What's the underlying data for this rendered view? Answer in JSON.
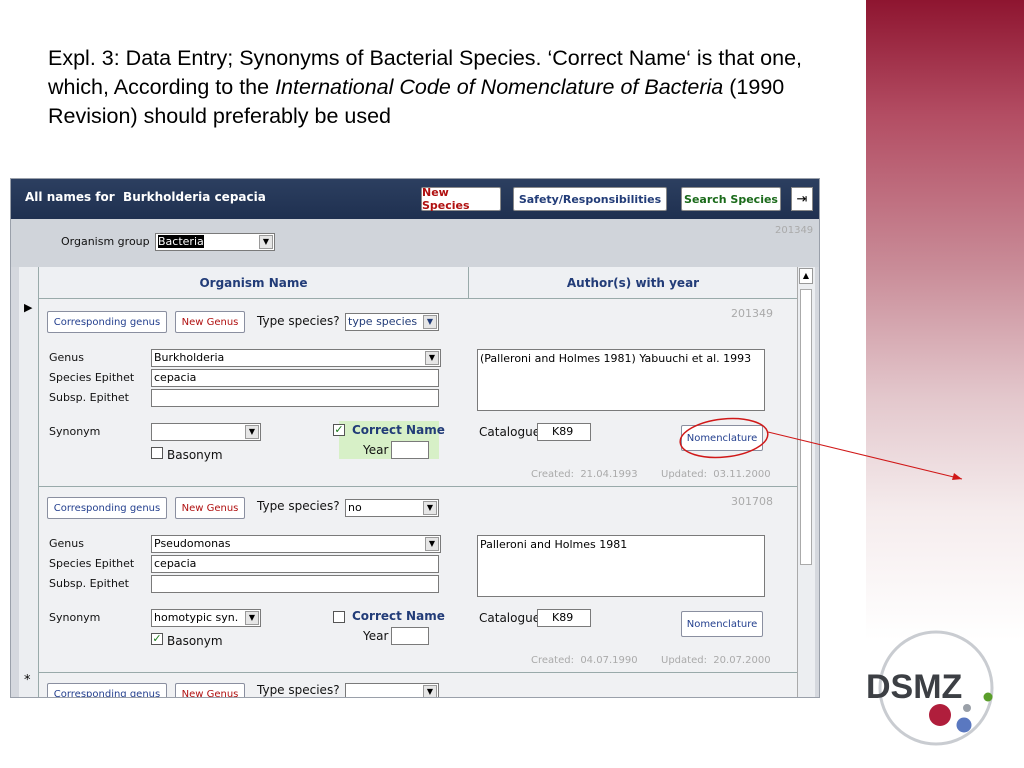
{
  "caption": {
    "part1": "Expl. 3: Data Entry; Synonyms of Bacterial Species. ‘Correct Name‘ is that one, which, According to the ",
    "italic1": "International Code of Nomenclature of Bacteria",
    "part2": " (1990 Revision) should preferably be used"
  },
  "window": {
    "title_prefix": "All names for",
    "title_name": "Burkholderia cepacia",
    "buttons": {
      "new_species": "New Species",
      "safety": "Safety/Responsibilities",
      "search": "Search Species"
    },
    "exit_icon": "exit-door-icon",
    "organism_group_label": "Organism group",
    "organism_group_value": "Bacteria",
    "record_id": "201349"
  },
  "grid": {
    "col_name": "Organism Name",
    "col_author": "Author(s) with year",
    "labels": {
      "corresponding_genus": "Corresponding genus",
      "new_genus": "New Genus",
      "type_species_q": "Type species?",
      "genus": "Genus",
      "species_epithet": "Species Epithet",
      "subsp_epithet": "Subsp. Epithet",
      "synonym": "Synonym",
      "basonym": "Basonym",
      "correct_name": "Correct Name",
      "year": "Year",
      "catalogue": "Catalogue",
      "nomenclature": "Nomenclature",
      "created": "Created:",
      "updated": "Updated:"
    },
    "records": [
      {
        "type_species": "type species",
        "id": "201349",
        "genus": "Burkholderia",
        "species_epithet": "cepacia",
        "subsp_epithet": "",
        "synonym": "",
        "basonym": false,
        "correct_name": true,
        "year": "",
        "author": "(Palleroni and Holmes 1981) Yabuuchi et al. 1993",
        "catalogue": "K89",
        "created": "21.04.1993",
        "updated": "03.11.2000"
      },
      {
        "type_species": "no",
        "id": "301708",
        "genus": "Pseudomonas",
        "species_epithet": "cepacia",
        "subsp_epithet": "",
        "synonym": "homotypic syn.",
        "basonym": true,
        "correct_name": false,
        "year": "",
        "author": "Palleroni and Holmes 1981",
        "catalogue": "K89",
        "created": "04.07.1990",
        "updated": "20.07.2000"
      },
      {
        "type_species": ""
      }
    ]
  },
  "logo": {
    "text": "DSMZ"
  },
  "colors": {
    "accent_red": "#d01818",
    "title_bar": "#1f3050",
    "label_blue": "#223c78"
  }
}
